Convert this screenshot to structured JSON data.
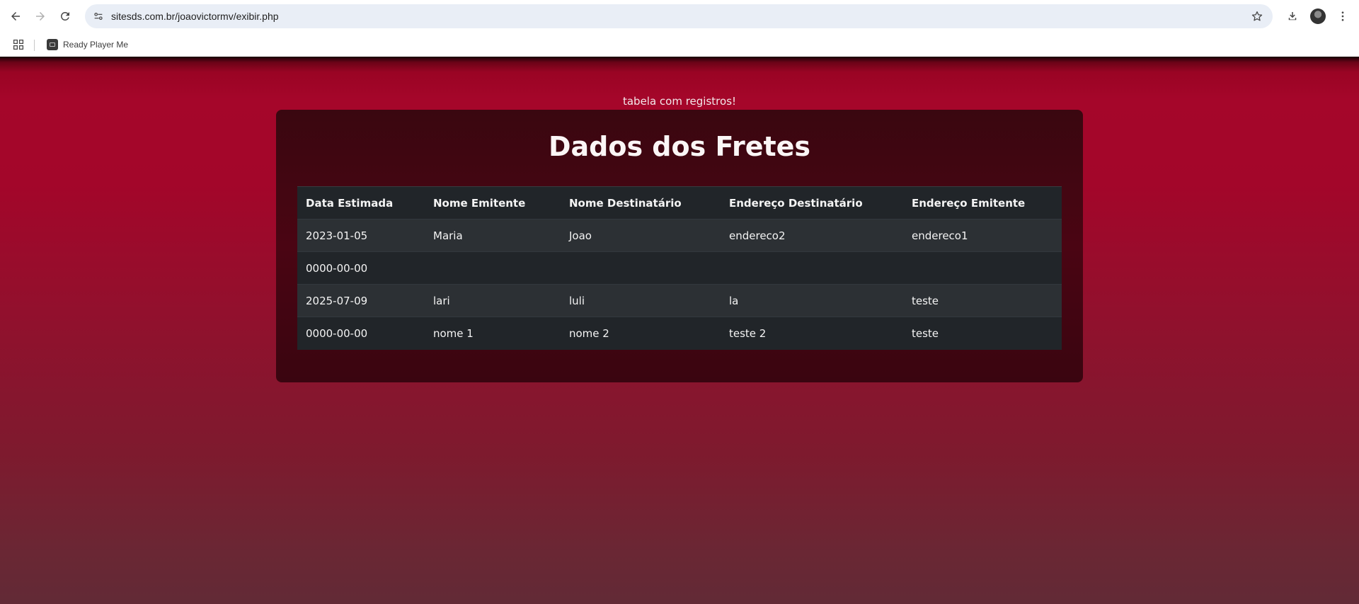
{
  "browser": {
    "url": "sitesds.com.br/joaovictormv/exibir.php",
    "bookmarks": [
      {
        "label": "Ready Player Me"
      }
    ]
  },
  "page": {
    "subtitle": "tabela com registros!",
    "title": "Dados dos Fretes",
    "table": {
      "headers": [
        "Data Estimada",
        "Nome Emitente",
        "Nome Destinatário",
        "Endereço Destinatário",
        "Endereço Emitente"
      ],
      "rows": [
        [
          "2023-01-05",
          "Maria",
          "Joao",
          "endereco2",
          "endereco1"
        ],
        [
          "0000-00-00",
          "",
          "",
          "",
          ""
        ],
        [
          "2025-07-09",
          "lari",
          "luli",
          "la",
          "teste"
        ],
        [
          "0000-00-00",
          "nome 1",
          "nome 2",
          "teste 2",
          "teste"
        ]
      ]
    }
  }
}
